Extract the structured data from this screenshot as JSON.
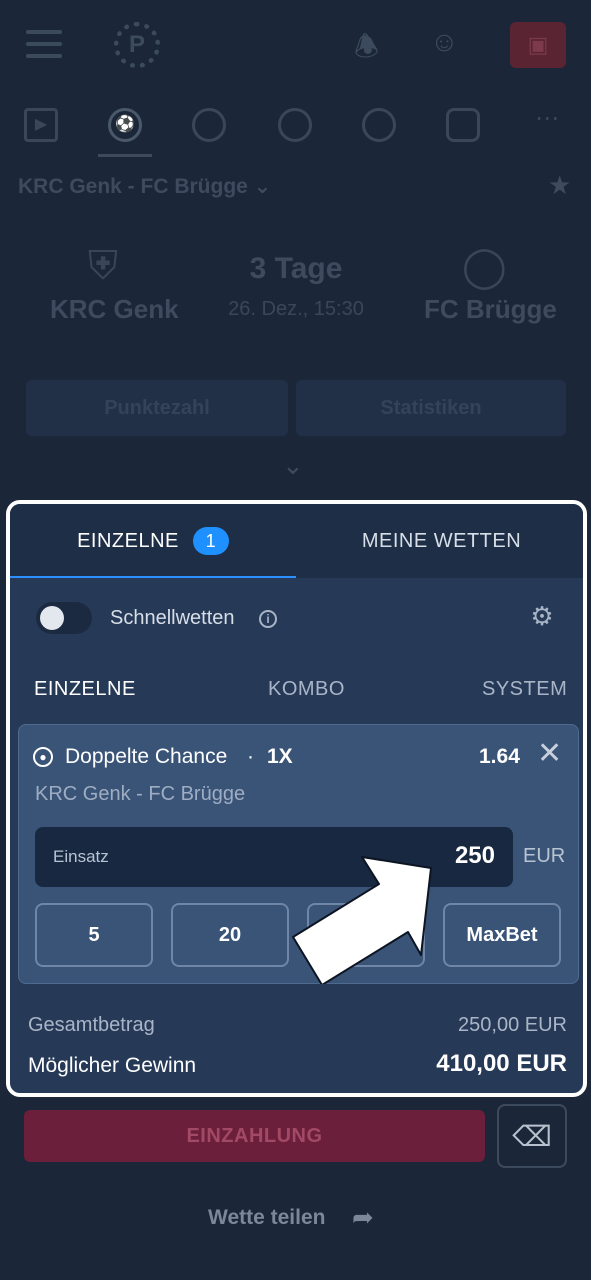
{
  "background": {
    "match_title": "KRC Genk - FC Brügge",
    "home_team": "KRC Genk",
    "away_team": "FC Brügge",
    "countdown": "3 Tage",
    "kickoff": "26. Dez., 15:30",
    "btn_left": "Punktezahl",
    "btn_right": "Statistiken"
  },
  "betslip": {
    "tabs": {
      "single": "EINZELNE",
      "single_count": "1",
      "mine": "MEINE WETTEN"
    },
    "quick_bets_label": "Schnellwetten",
    "subtabs": {
      "single": "EINZELNE",
      "combo": "KOMBO",
      "system": "SYSTEM"
    },
    "bet": {
      "market": "Doppelte Chance",
      "separator": "·",
      "selection": "1X",
      "odds": "1.64",
      "match": "KRC Genk - FC Brügge",
      "stake_label": "Einsatz",
      "stake_value": "250",
      "currency": "EUR",
      "quick_amounts": [
        "5",
        "20",
        "50",
        "MaxBet"
      ]
    },
    "total_label": "Gesamtbetrag",
    "total_value": "250,00 EUR",
    "win_label": "Möglicher Gewinn",
    "win_value": "410,00 EUR"
  },
  "footer": {
    "deposit_label": "EINZAHLUNG",
    "share_label": "Wette teilen"
  },
  "colors": {
    "accent_blue": "#1e90ff",
    "panel_bg": "#263a58",
    "card_bg": "#3a5478",
    "deposit_bg": "#6b1f3a"
  }
}
